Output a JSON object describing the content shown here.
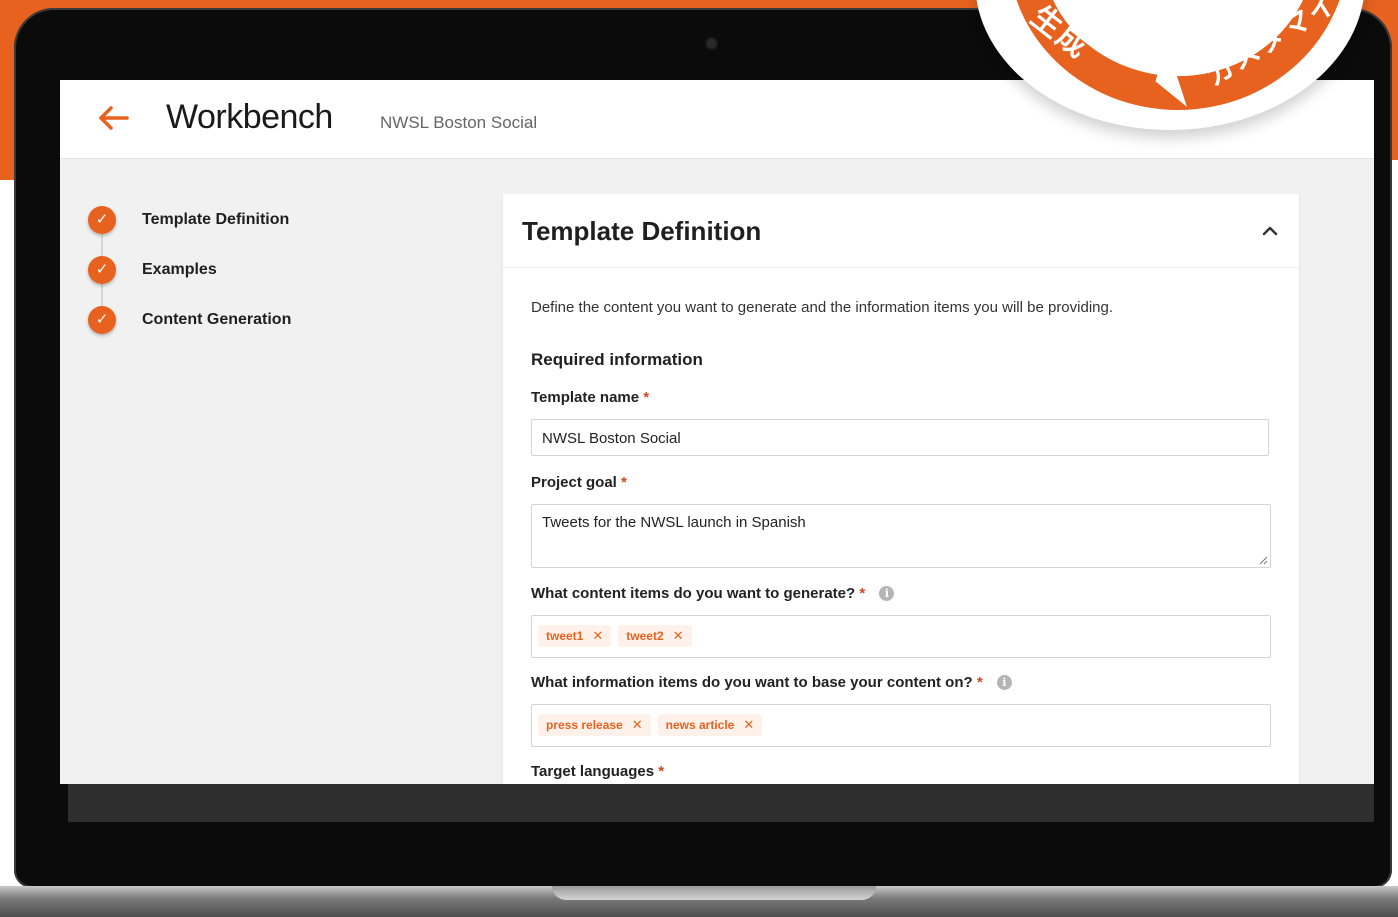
{
  "header": {
    "back_icon": "arrow-left-icon",
    "title": "Workbench",
    "subtitle": "NWSL Boston Social"
  },
  "steps": [
    {
      "label": "Template Definition",
      "done": true
    },
    {
      "label": "Examples",
      "done": true
    },
    {
      "label": "Content Generation",
      "done": true
    }
  ],
  "panel": {
    "title": "Template Definition",
    "description": "Define the content you want to generate and the information items you will be providing.",
    "section_heading": "Required information",
    "fields": {
      "template_name": {
        "label": "Template name",
        "required_mark": "*",
        "value": "NWSL Boston Social"
      },
      "project_goal": {
        "label": "Project goal",
        "required_mark": "*",
        "value": "Tweets for the NWSL launch in Spanish"
      },
      "content_items": {
        "label": "What content items do you want to generate?",
        "required_mark": "*",
        "tags": [
          "tweet1",
          "tweet2"
        ]
      },
      "information_items": {
        "label": "What information items do you want to base your content on?",
        "required_mark": "*",
        "tags": [
          "press release",
          "news article"
        ]
      },
      "target_languages": {
        "label": "Target languages",
        "required_mark": "*"
      }
    }
  },
  "badge": {
    "left_text": "生成",
    "right_text": "カスタマイ"
  },
  "colors": {
    "accent": "#e8621f",
    "required": "#d4471f",
    "screen_bg": "#f1f1f1"
  }
}
